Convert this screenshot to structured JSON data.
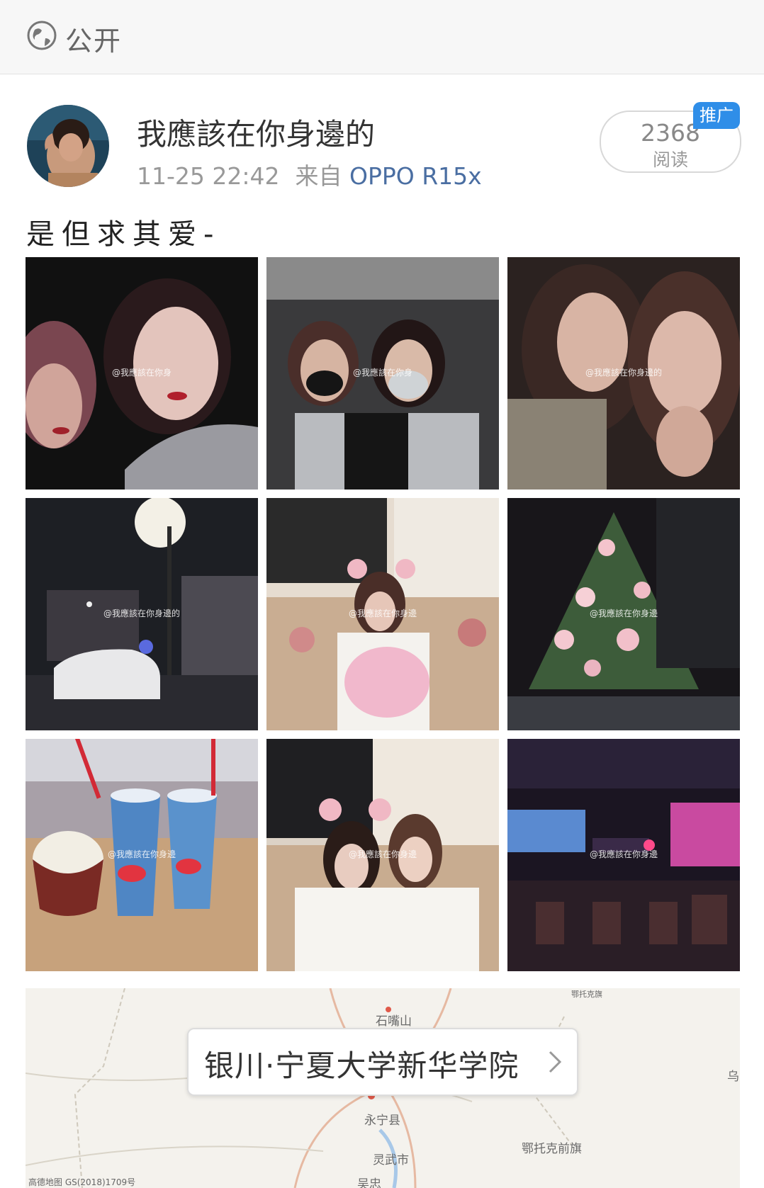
{
  "header": {
    "visibility_label": "公开",
    "icon": "globe-icon"
  },
  "post": {
    "username": "我應該在你身邊的",
    "timestamp": "11-25 22:42",
    "source_prefix": "来自",
    "device": "OPPO R15x",
    "read_count": "2368",
    "read_label": "阅读",
    "promo_badge": "推广",
    "text": "是但求其爱-"
  },
  "photos": [
    {
      "name": "photo-selfie-two-girls-night",
      "watermark": "@我應該在你身"
    },
    {
      "name": "photo-peace-signs-masks",
      "watermark": "@我應該在你身"
    },
    {
      "name": "photo-selfie-hand-on-face",
      "watermark": "@我應該在你身邊的"
    },
    {
      "name": "photo-rainy-street-night",
      "watermark": "@我應該在你身邊的"
    },
    {
      "name": "photo-girl-cat-ears-pink-plush",
      "watermark": "@我應該在你身邊"
    },
    {
      "name": "photo-rose-tree-night",
      "watermark": "@我應該在你身邊"
    },
    {
      "name": "photo-dq-cups-dessert",
      "watermark": "@我應該在你身邊"
    },
    {
      "name": "photo-two-girls-cat-ears",
      "watermark": "@我應該在你身邊"
    },
    {
      "name": "photo-bar-interior-neon",
      "watermark": "@我應該在你身邊"
    }
  ],
  "location": {
    "name": "银川·宁夏大学新华学院",
    "map_labels": {
      "a": "石嘴山",
      "b": "永宁县",
      "c": "灵武市",
      "d": "鄂托克前旗",
      "e": "乌",
      "f": "吴忠",
      "top": "鄂托克旗"
    },
    "copyright": "高德地图 GS(2018)1709号"
  },
  "colors": {
    "link": "#4a6ea2",
    "promo": "#2f8ee8",
    "meta_text": "#999999"
  }
}
